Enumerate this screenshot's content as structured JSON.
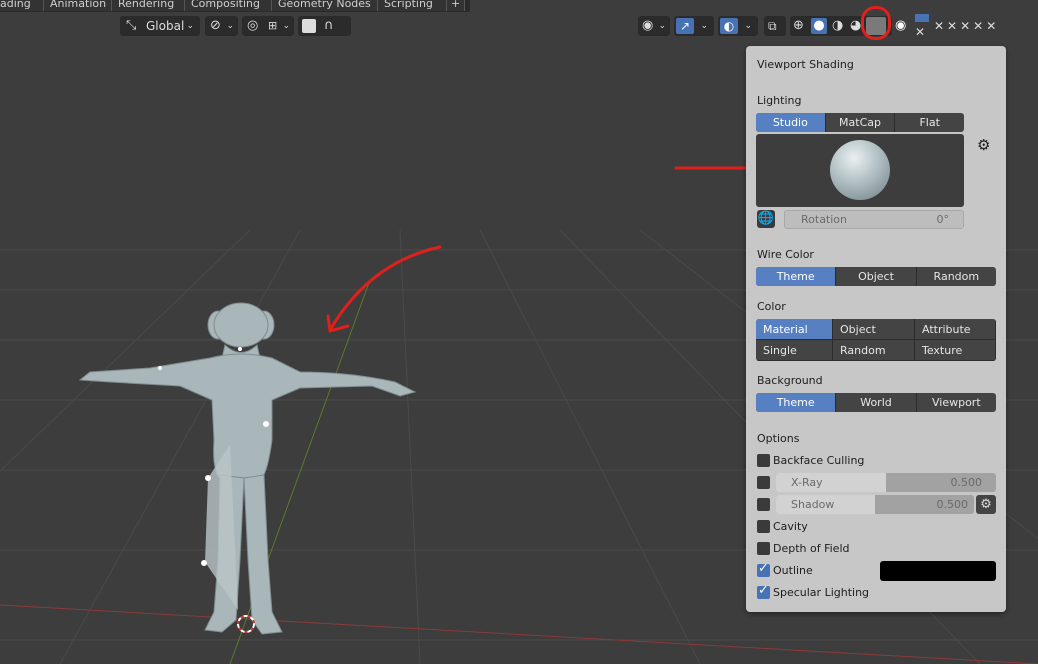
{
  "workspace_tabs": [
    "ading",
    "Animation",
    "Rendering",
    "Compositing",
    "Geometry Nodes",
    "Scripting",
    "+"
  ],
  "header": {
    "orientation_label": "Global",
    "transform_icons": [
      "transform-orientation-icon",
      "pivot-icon",
      "snap-icon",
      "proportional-edit-icon",
      "falloff-icon"
    ],
    "right_icons": [
      "visibility-icon",
      "gizmo-icon",
      "overlay-icon",
      "xray-toggle-icon",
      "wireframe-shading-icon",
      "solid-shading-icon",
      "material-shading-icon",
      "rendered-shading-icon",
      "shading-dropdown-icon"
    ]
  },
  "shading_popup": {
    "title": "Viewport Shading",
    "lighting": {
      "label": "Lighting",
      "options": [
        "Studio",
        "MatCap",
        "Flat"
      ],
      "selected": "Studio",
      "rotation_label": "Rotation",
      "rotation_value": "0°"
    },
    "wire_color": {
      "label": "Wire Color",
      "options": [
        "Theme",
        "Object",
        "Random"
      ],
      "selected": "Theme"
    },
    "color": {
      "label": "Color",
      "options": [
        "Material",
        "Object",
        "Attribute",
        "Single",
        "Random",
        "Texture"
      ],
      "selected": "Material"
    },
    "background": {
      "label": "Background",
      "options": [
        "Theme",
        "World",
        "Viewport"
      ],
      "selected": "Theme"
    },
    "options": {
      "label": "Options",
      "backface_culling": {
        "label": "Backface Culling",
        "checked": false
      },
      "xray": {
        "label": "X-Ray",
        "value": "0.500",
        "checked": false
      },
      "shadow": {
        "label": "Shadow",
        "value": "0.500",
        "checked": false
      },
      "cavity": {
        "label": "Cavity",
        "checked": false
      },
      "depth_of_field": {
        "label": "Depth of Field",
        "checked": false
      },
      "outline": {
        "label": "Outline",
        "checked": true,
        "color": "#000000"
      },
      "specular_lighting": {
        "label": "Specular Lighting",
        "checked": true
      }
    }
  },
  "colors": {
    "viewport_bg": "#3d3d3d",
    "panel_bg": "#c7c7c7",
    "accent": "#5680c2",
    "annotation": "#e0201c"
  }
}
